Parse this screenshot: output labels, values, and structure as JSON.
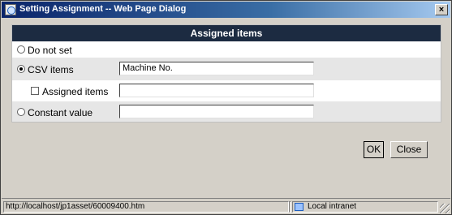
{
  "window": {
    "title": "Setting Assignment -- Web Page Dialog",
    "close_glyph": "×"
  },
  "panel": {
    "header": "Assigned items",
    "options": {
      "not_set": {
        "label": "Do not set",
        "checked": false
      },
      "csv": {
        "label": "CSV items",
        "checked": true,
        "value": "Machine No."
      },
      "assigned": {
        "label": "Assigned items",
        "checked": false,
        "value": ""
      },
      "constant": {
        "label": "Constant value",
        "checked": false,
        "value": ""
      }
    }
  },
  "buttons": {
    "ok": "OK",
    "close": "Close"
  },
  "statusbar": {
    "url": "http://localhost/jp1asset/60009400.htm",
    "zone": "Local intranet"
  },
  "colors": {
    "header_bg": "#1c2b41",
    "title_start": "#0a246a",
    "title_end": "#a6caf0",
    "row_gray": "#e6e6e6"
  }
}
